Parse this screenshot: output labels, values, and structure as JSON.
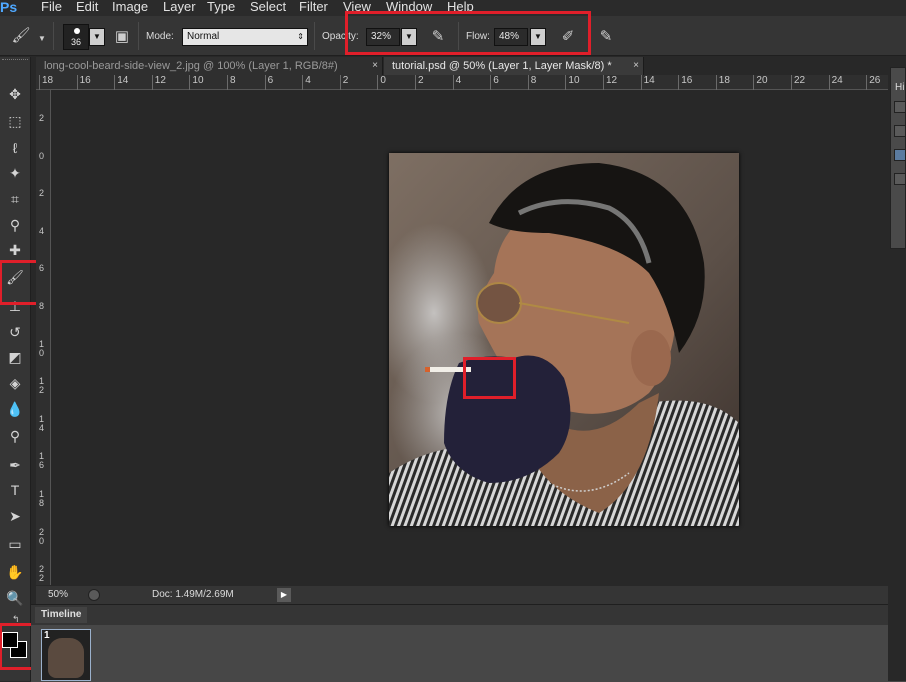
{
  "app": {
    "logo": "Ps"
  },
  "menu": [
    "File",
    "Edit",
    "Image",
    "Layer",
    "Type",
    "Select",
    "Filter",
    "View",
    "Window",
    "Help"
  ],
  "options": {
    "brush_size": "36",
    "mode_label": "Mode:",
    "mode_value": "Normal",
    "opacity_label": "Opacity:",
    "opacity_value": "32%",
    "flow_label": "Flow:",
    "flow_value": "48%"
  },
  "tabs": [
    {
      "label": "long-cool-beard-side-view_2.jpg @ 100% (Layer 1, RGB/8#)",
      "close": "×",
      "active": false
    },
    {
      "label": "tutorial.psd @ 50% (Layer 1, Layer Mask/8) *",
      "close": "×",
      "active": true
    }
  ],
  "ruler_top": [
    "18",
    "16",
    "14",
    "12",
    "10",
    "8",
    "6",
    "4",
    "2",
    "0",
    "2",
    "4",
    "6",
    "8",
    "10",
    "12",
    "14",
    "16",
    "18",
    "20",
    "22",
    "24",
    "26"
  ],
  "ruler_left": [
    "2",
    "0",
    "2",
    "4",
    "6",
    "8",
    "1 0",
    "1 2",
    "1 4",
    "1 6",
    "1 8",
    "2 0",
    "2 2"
  ],
  "status": {
    "zoom": "50%",
    "doc": "Doc: 1.49M/2.69M"
  },
  "timeline": {
    "title": "Timeline",
    "frame_number": "1"
  },
  "right_panel": {
    "label": "Hi"
  },
  "tools": [
    "move-tool-icon",
    "marquee-tool-icon",
    "lasso-tool-icon",
    "quick-selection-tool-icon",
    "crop-tool-icon",
    "eyedropper-tool-icon",
    "healing-brush-tool-icon",
    "brush-tool-icon",
    "clone-stamp-tool-icon",
    "history-brush-tool-icon",
    "eraser-tool-icon",
    "paint-bucket-tool-icon",
    "blur-tool-icon",
    "dodge-tool-icon",
    "pen-tool-icon",
    "type-tool-icon",
    "path-selection-tool-icon",
    "rectangle-tool-icon",
    "hand-tool-icon",
    "zoom-tool-icon"
  ],
  "colors": {
    "foreground": "#000000",
    "background": "#ffffff",
    "highlight": "#e01f2a"
  }
}
